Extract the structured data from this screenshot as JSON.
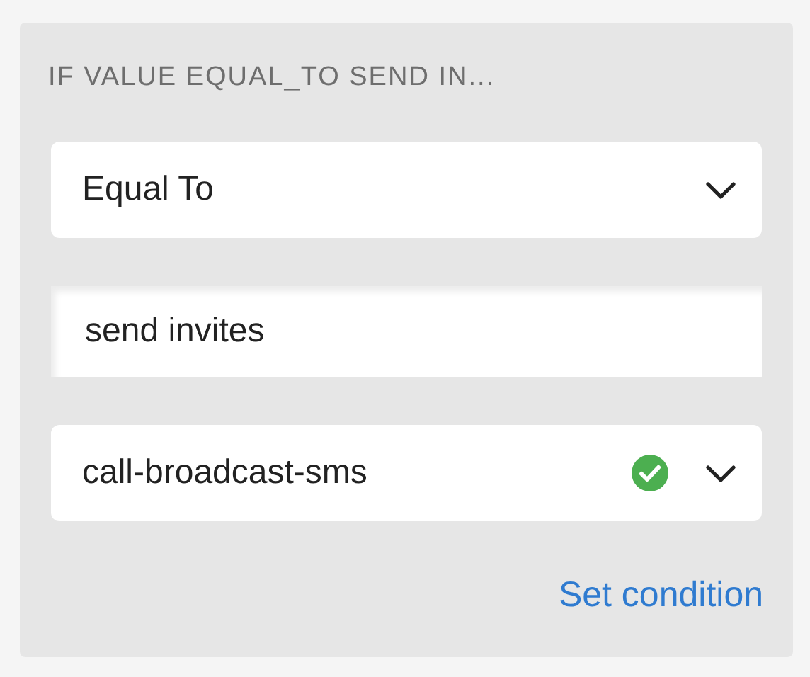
{
  "header": "IF VALUE EQUAL_TO SEND IN...",
  "operator_select": {
    "value": "Equal To"
  },
  "value_field": {
    "value": "send invites"
  },
  "target_select": {
    "value": "call-broadcast-sms",
    "valid": true
  },
  "link": "Set condition"
}
